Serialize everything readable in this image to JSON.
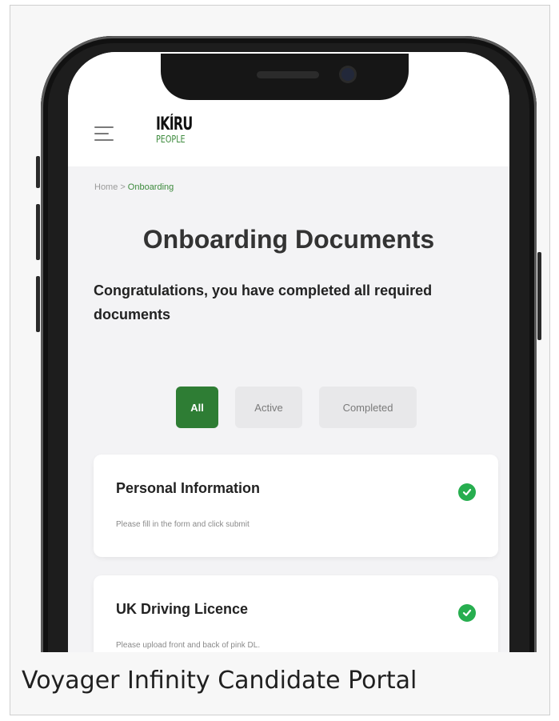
{
  "header": {
    "logo_main": "IKÍRU",
    "logo_sub": "PEOPLE"
  },
  "breadcrumb": {
    "home": "Home",
    "separator": ">",
    "current": "Onboarding"
  },
  "page": {
    "title": "Onboarding Documents",
    "subtitle": "Congratulations, you have completed all required documents"
  },
  "filters": [
    {
      "label": "All",
      "selected": true
    },
    {
      "label": "Active",
      "selected": false
    },
    {
      "label": "Completed",
      "selected": false
    }
  ],
  "cards": [
    {
      "title": "Personal Information",
      "description": "Please fill in the form and click submit",
      "status": "complete"
    },
    {
      "title": "UK Driving Licence",
      "description": "Please upload front and back of pink DL.",
      "status": "complete"
    }
  ],
  "caption": "Voyager Infinity Candidate Portal",
  "colors": {
    "brand_green": "#2e7d34",
    "check_green": "#27ae4f",
    "background": "#f3f3f5"
  },
  "icons": {
    "menu": "hamburger-icon",
    "status": "check-circle-icon"
  }
}
